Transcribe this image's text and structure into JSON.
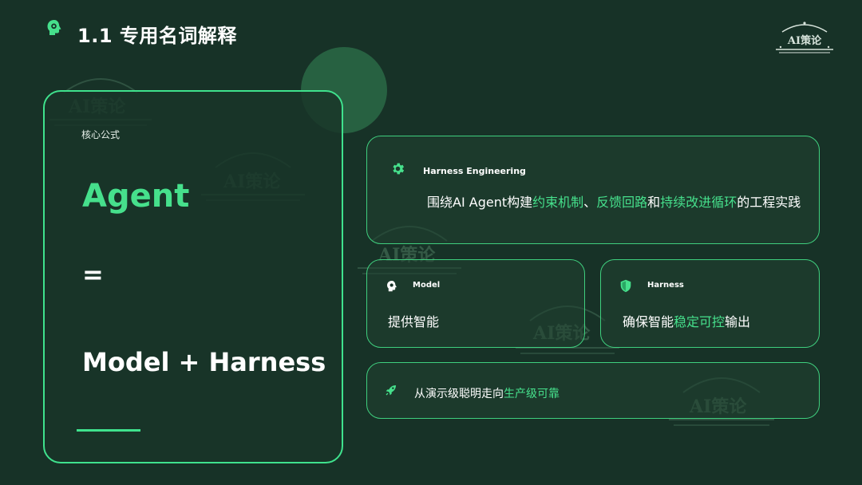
{
  "header": {
    "title": "1.1 专用名词解释",
    "icon": "brain-gear-icon",
    "logo_text": "AI策论"
  },
  "watermark_text": "AI策论",
  "colors": {
    "background": "#173227",
    "accent": "#46e08c",
    "border": "#3fe28d",
    "decor_circle": "#2a6a47"
  },
  "left_panel": {
    "label": "核心公式",
    "term": "Agent",
    "equals": "=",
    "formula": "Model + Harness"
  },
  "cards": {
    "harness_engineering": {
      "icon": "gear-icon",
      "title": "Harness Engineering",
      "body_parts": [
        "围绕AI Agent构建",
        "约束机制",
        "、",
        "反馈回路",
        "和",
        "持续改进循环",
        "的工程实践"
      ]
    },
    "model": {
      "icon": "brain-icon",
      "title": "Model",
      "body": "提供智能"
    },
    "harness": {
      "icon": "shield-icon",
      "title": "Harness",
      "body_parts": [
        "确保智能",
        "稳定可控",
        "输出"
      ]
    },
    "production": {
      "icon": "rocket-icon",
      "body_parts": [
        "从演示级聪明走向",
        "生产级可靠"
      ]
    }
  }
}
